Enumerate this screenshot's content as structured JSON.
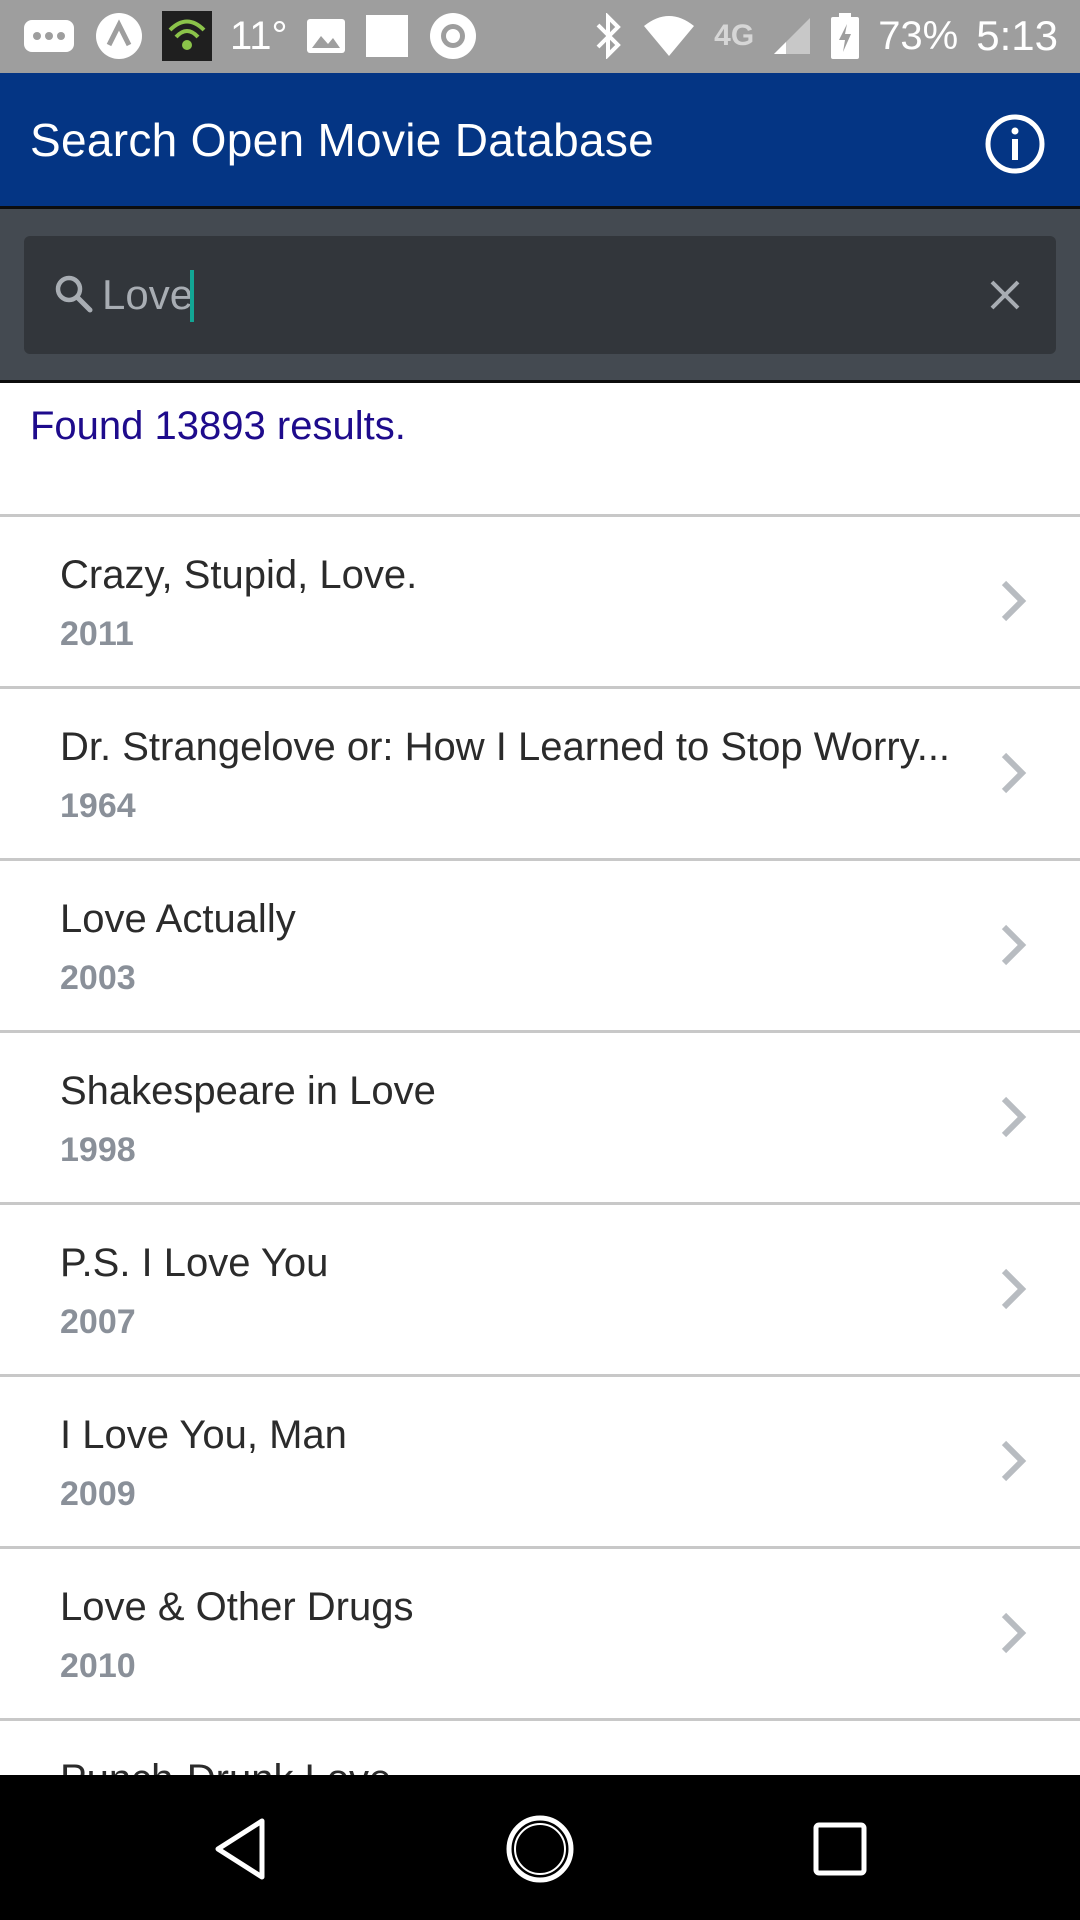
{
  "status_bar": {
    "temperature": "11°",
    "network": "4G",
    "battery": "73%",
    "time": "5:13",
    "icons": [
      "more-notifications-icon",
      "app-notification-icon",
      "wifi-hotspot-icon",
      "image-icon",
      "square-notification-icon",
      "sync-icon",
      "bluetooth-icon",
      "wifi-icon",
      "signal-icon",
      "battery-charging-icon"
    ]
  },
  "app_bar": {
    "title": "Search Open Movie Database",
    "info_icon": "info-icon"
  },
  "search": {
    "value": "Love",
    "placeholder": "",
    "search_icon": "search-icon",
    "clear_icon": "close-icon"
  },
  "results": {
    "count_text": "Found 13893 results.",
    "items": [
      {
        "title": "Crazy, Stupid, Love.",
        "year": "2011"
      },
      {
        "title": "Dr. Strangelove or: How I Learned to Stop Worry...",
        "year": "1964"
      },
      {
        "title": "Love Actually",
        "year": "2003"
      },
      {
        "title": "Shakespeare in Love",
        "year": "1998"
      },
      {
        "title": "P.S. I Love You",
        "year": "2007"
      },
      {
        "title": "I Love You, Man",
        "year": "2009"
      },
      {
        "title": "Love & Other Drugs",
        "year": "2010"
      },
      {
        "title": "Punch-Drunk Love",
        "year": ""
      }
    ]
  },
  "nav_bar": {
    "icons": [
      "back-icon",
      "home-icon",
      "recents-icon"
    ]
  },
  "colors": {
    "app_bar": "#043584",
    "search_area": "#444a51",
    "search_box": "#32363b",
    "count_text": "#1e0b8c",
    "caret": "#12a594"
  }
}
